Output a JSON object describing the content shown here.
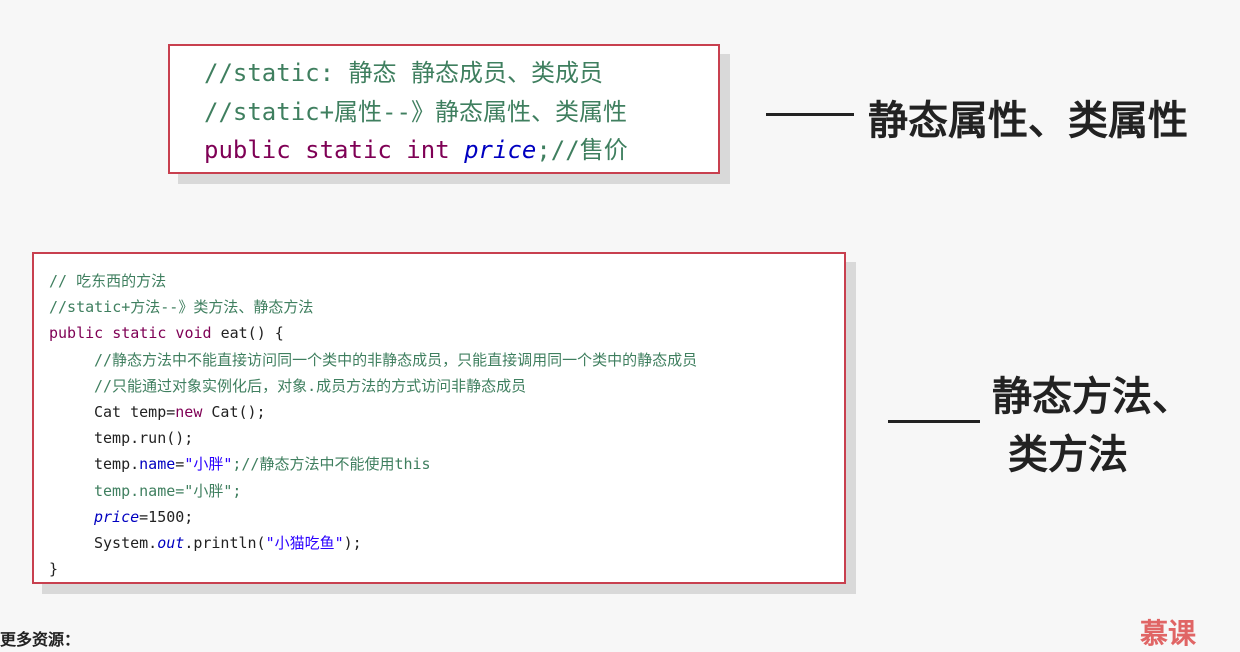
{
  "slide": {
    "box1": {
      "lines": [
        {
          "a": "//static: 静态 静态成员、类成员"
        },
        {
          "a": "//static+属性--》静态属性、类属性"
        },
        {
          "a": "public static int ",
          "b": "price",
          "c": ";//售价"
        }
      ]
    },
    "box1_label": "静态属性、类属性",
    "box2": {
      "l1": "// 吃东西的方法",
      "l2": "//static+方法--》类方法、静态方法",
      "l3": {
        "kw": "public static void ",
        "rest": "eat() {"
      },
      "l4": "//静态方法中不能直接访问同一个类中的非静态成员，只能直接调用同一个类中的静态成员",
      "l5": "//只能通过对象实例化后，对象.成员方法的方式访问非静态成员",
      "l6": {
        "a": "Cat ",
        "b": "temp",
        "c": "=",
        "d": "new",
        "e": " Cat();"
      },
      "l7": {
        "a": "temp",
        "b": ".run();"
      },
      "l8": {
        "a": "temp",
        "b": ".",
        "c": "name",
        "d": "=",
        "e": "\"小胖\"",
        "f": ";//静态方法中不能使用this"
      },
      "l9": "temp.name=\"小胖\";",
      "l10": {
        "a": "price",
        "b": "=1500;"
      },
      "l11": {
        "a": "System.",
        "b": "out",
        "c": ".println(",
        "d": "\"小猫吃鱼\"",
        "e": ");"
      },
      "l12": "}"
    },
    "box2_label_line1": "静态方法、",
    "box2_label_line2": "类方法",
    "watermark": "更多资源：",
    "logo": "慕课"
  },
  "colors": {
    "border": "#c8404f",
    "comment": "#3f7f5f",
    "keyword": "#7f0055",
    "string": "#2a00ff",
    "field": "#0000c0"
  }
}
